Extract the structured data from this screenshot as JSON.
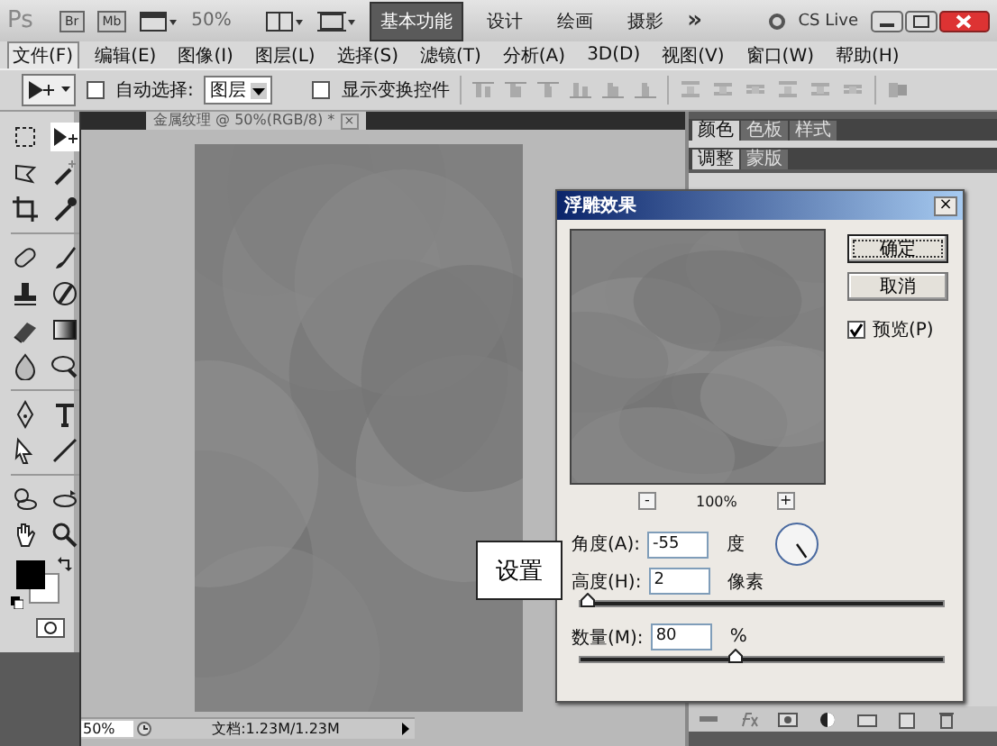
{
  "app_bar": {
    "logo": "Ps",
    "bridge_buttons": [
      "Br",
      "Mb"
    ],
    "zoom": "50%",
    "workspaces": [
      {
        "label": "基本功能",
        "selected": true
      },
      {
        "label": "设计",
        "selected": false
      },
      {
        "label": "绘画",
        "selected": false
      },
      {
        "label": "摄影",
        "selected": false
      }
    ],
    "more": "»",
    "cs_live": "CS Live"
  },
  "menu": [
    {
      "label": "文件(F)",
      "selected": true
    },
    {
      "label": "编辑(E)",
      "selected": false
    },
    {
      "label": "图像(I)",
      "selected": false
    },
    {
      "label": "图层(L)",
      "selected": false
    },
    {
      "label": "选择(S)",
      "selected": false
    },
    {
      "label": "滤镜(T)",
      "selected": false
    },
    {
      "label": "分析(A)",
      "selected": false
    },
    {
      "label": "3D(D)",
      "selected": false
    },
    {
      "label": "视图(V)",
      "selected": false
    },
    {
      "label": "窗口(W)",
      "selected": false
    },
    {
      "label": "帮助(H)",
      "selected": false
    }
  ],
  "options_bar": {
    "auto_select": {
      "label": "自动选择:",
      "checked": false
    },
    "auto_select_value": "图层",
    "show_transform": {
      "label": "显示变换控件",
      "checked": false
    }
  },
  "document_tab": {
    "title": "金属纹理 @ 50%(RGB/8) *",
    "close": "×"
  },
  "panels": {
    "top_tabs": [
      {
        "label": "颜色",
        "selected": true
      },
      {
        "label": "色板",
        "selected": false
      },
      {
        "label": "样式",
        "selected": false
      }
    ],
    "second_tabs": [
      {
        "label": "调整",
        "selected": true
      },
      {
        "label": "蒙版",
        "selected": false
      }
    ]
  },
  "dialog": {
    "title": "浮雕效果",
    "close": "×",
    "buttons": [
      "确定",
      "取消"
    ],
    "preview": {
      "label": "预览(P)",
      "checked": true
    },
    "zoom": {
      "minus": "-",
      "value": "100%",
      "plus": "+"
    },
    "angle": {
      "label": "角度(A):",
      "value": "-55",
      "unit": "度"
    },
    "height": {
      "label": "高度(H):",
      "value": "2",
      "unit": "像素",
      "level": 0.02
    },
    "amount": {
      "label": "数量(M):",
      "value": "80",
      "unit": "%",
      "level": 0.43
    }
  },
  "callout": "设置",
  "status_bar": {
    "zoom": "50%",
    "doc_info": "文档:1.23M/1.23M"
  }
}
